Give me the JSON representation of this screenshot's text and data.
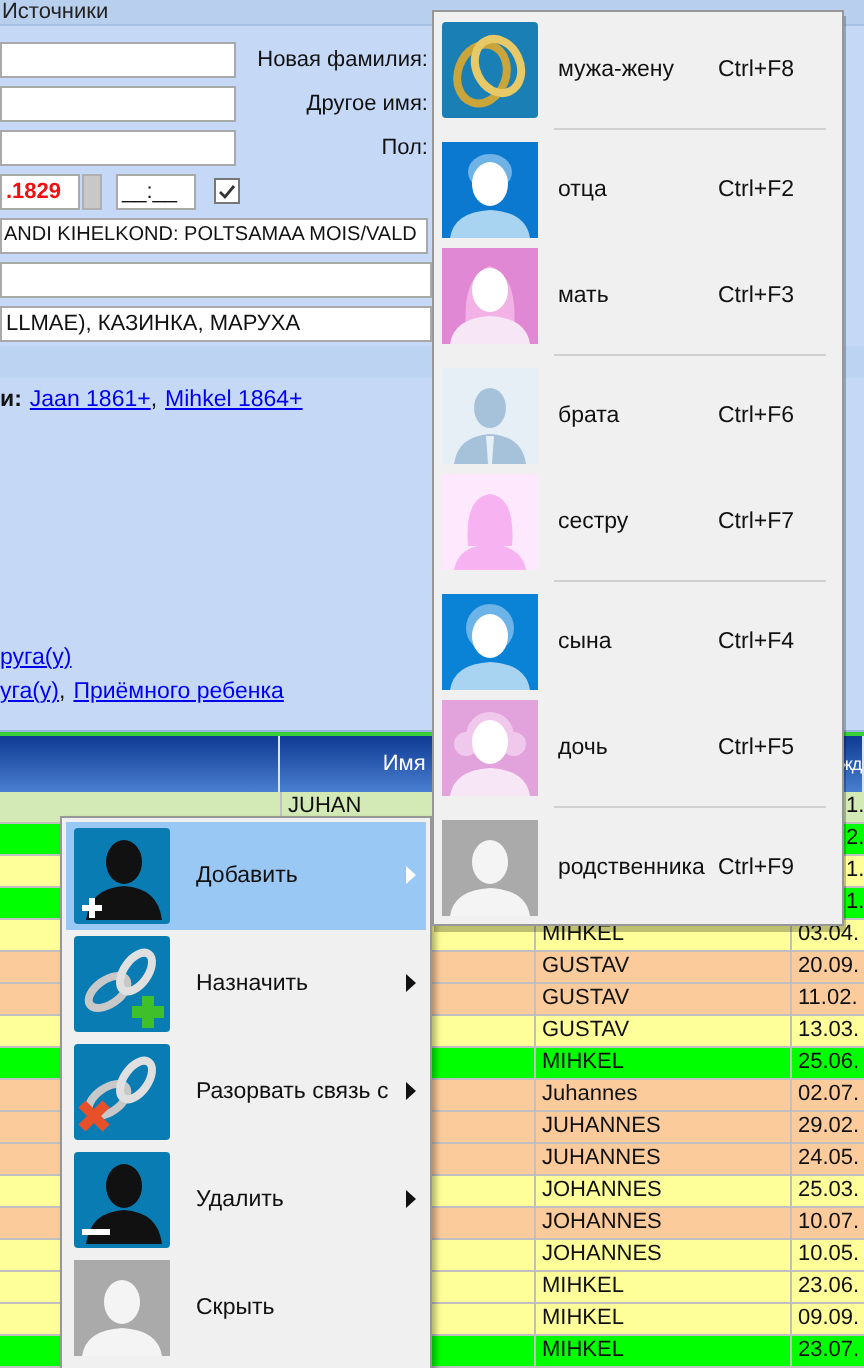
{
  "tab": {
    "label": "Источники"
  },
  "form": {
    "rows": [
      {
        "label": "Новая фамилия:"
      },
      {
        "label": "Другое имя:"
      },
      {
        "label": "Пол:"
      }
    ],
    "date": ".1829",
    "time": "__:__",
    "confirmed": true,
    "place": "ANDI KIHELKOND: POLTSAMAA MOIS/VALD",
    "names": "LLMAE), КАЗИНКА, МАРУХА"
  },
  "children_line": {
    "label": "и:",
    "parts": [
      {
        "kind": "link",
        "text": "Jaan 1861+"
      },
      {
        "kind": "text",
        "text": ","
      },
      {
        "kind": "link",
        "text": "Mihkel 1864+"
      }
    ]
  },
  "add_lines": [
    {
      "parts": [
        {
          "kind": "link",
          "text": "руга(у)"
        }
      ]
    },
    {
      "parts": [
        {
          "kind": "link",
          "text": "уга(у)"
        },
        {
          "kind": "text",
          "text": ","
        },
        {
          "kind": "link",
          "text": "Приёмного ребенка"
        }
      ]
    }
  ],
  "grid": {
    "columns": [
      {
        "label": "Имя",
        "covered": false
      },
      {
        "label": "жд",
        "covered": true
      }
    ],
    "rows": [
      {
        "color": "#d3eab6",
        "name": "JUHAN",
        "column_4": "1.",
        "covered": true
      },
      {
        "color": "#00ff00",
        "column_4": "2.",
        "covered": true
      },
      {
        "color": "#ffff99",
        "column_4": "1.",
        "covered": true
      },
      {
        "color": "#00ff00",
        "column_4": "1.",
        "covered": true
      },
      {
        "color": "#ffff99",
        "column_3": "MIHKEL",
        "column_4": "03.04.",
        "covered": false
      },
      {
        "color": "#fbcb9c",
        "column_3": "GUSTAV",
        "column_4": "20.09.",
        "covered": false
      },
      {
        "color": "#fbcb9c",
        "column_3": "GUSTAV",
        "column_4": "11.02.",
        "covered": false
      },
      {
        "color": "#ffff99",
        "column_3": "GUSTAV",
        "column_4": "13.03.",
        "covered": false
      },
      {
        "color": "#00ff00",
        "column_3": "MIHKEL",
        "column_4": "25.06.",
        "covered": false
      },
      {
        "color": "#fbcb9c",
        "column_3": "Juhannes",
        "column_4": "02.07.",
        "covered": false
      },
      {
        "color": "#fbcb9c",
        "column_3": "JUHANNES",
        "column_4": "29.02.",
        "covered": false
      },
      {
        "color": "#fbcb9c",
        "column_3": "JUHANNES",
        "column_4": "24.05.",
        "covered": false
      },
      {
        "color": "#ffff99",
        "column_3": "JOHANNES",
        "column_4": "25.03.",
        "covered": false
      },
      {
        "color": "#fbcb9c",
        "column_3": "JOHANNES",
        "column_4": "10.07.",
        "covered": false
      },
      {
        "color": "#ffff99",
        "column_3": "JOHANNES",
        "column_4": "10.05.",
        "covered": false
      },
      {
        "color": "#ffff99",
        "column_3": "MIHKEL",
        "column_4": "23.06.",
        "covered": false
      },
      {
        "color": "#ffff99",
        "column_3": "MIHKEL",
        "column_4": "09.09.",
        "covered": false
      },
      {
        "color": "#00ff00",
        "column_3": "MIHKEL",
        "column_4": "23.07.",
        "covered": false
      }
    ]
  },
  "context_menu": {
    "items": [
      {
        "label": "Добавить",
        "kind": "person-add",
        "has_submenu": true,
        "selected": true
      },
      {
        "label": "Назначить",
        "kind": "link-add",
        "has_submenu": true,
        "selected": false
      },
      {
        "label": "Разорвать связь с",
        "kind": "link-remove",
        "has_submenu": true,
        "selected": false
      },
      {
        "label": "Удалить",
        "kind": "person-remove",
        "has_submenu": true,
        "selected": false
      },
      {
        "label": "Скрыть",
        "kind": "person-gray",
        "has_submenu": false,
        "selected": false
      }
    ]
  },
  "submenu": {
    "groups": [
      {
        "items": [
          {
            "label": "мужа-жену",
            "shortcut": "Ctrl+F8",
            "kind": "rings"
          }
        ]
      },
      {
        "items": [
          {
            "label": "отца",
            "shortcut": "Ctrl+F2",
            "kind": "man"
          },
          {
            "label": "мать",
            "shortcut": "Ctrl+F3",
            "kind": "woman"
          }
        ]
      },
      {
        "items": [
          {
            "label": "брата",
            "shortcut": "Ctrl+F6",
            "kind": "brother"
          },
          {
            "label": "сестру",
            "shortcut": "Ctrl+F7",
            "kind": "sister"
          }
        ]
      },
      {
        "items": [
          {
            "label": "сына",
            "shortcut": "Ctrl+F4",
            "kind": "boy"
          },
          {
            "label": "дочь",
            "shortcut": "Ctrl+F5",
            "kind": "girl"
          }
        ]
      },
      {
        "items": [
          {
            "label": "родственника",
            "shortcut": "Ctrl+F9",
            "kind": "relative"
          }
        ]
      }
    ]
  }
}
